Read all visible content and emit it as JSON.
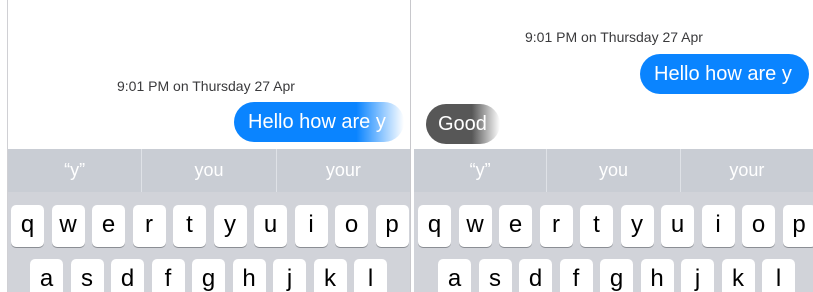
{
  "left_panel": {
    "timestamp": "9:01 PM on Thursday 27 Apr",
    "outgoing_message": "Hello how are y",
    "predictions": [
      "“y”",
      "you",
      "your"
    ]
  },
  "right_panel": {
    "timestamp": "9:01 PM on Thursday 27 Apr",
    "outgoing_message": "Hello how are y",
    "incoming_message": "Good",
    "predictions": [
      "“y”",
      "you",
      "your"
    ]
  },
  "keyboard": {
    "row1": [
      "q",
      "w",
      "e",
      "r",
      "t",
      "y",
      "u",
      "i",
      "o",
      "p"
    ],
    "row2": [
      "a",
      "s",
      "d",
      "f",
      "g",
      "h",
      "j",
      "k",
      "l"
    ]
  },
  "colors": {
    "outgoing_bubble": "#0a84ff",
    "incoming_bubble": "#575757",
    "keyboard_bg": "#d1d3d9",
    "prediction_bar": "#c9cdd4"
  }
}
